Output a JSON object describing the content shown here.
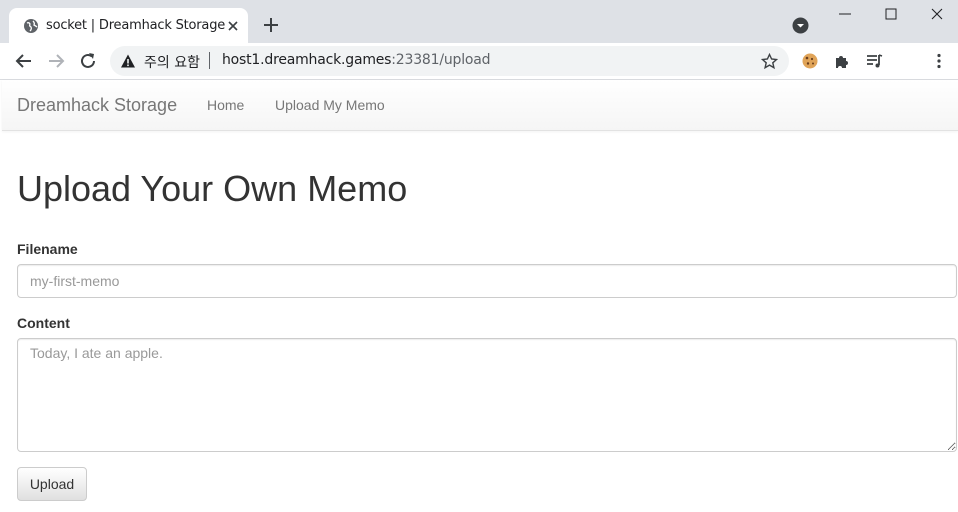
{
  "browser": {
    "tab_title": "socket | Dreamhack Storage",
    "security_label": "주의 요함",
    "url_host": "host1.dreamhack.games",
    "url_path": ":23381/upload"
  },
  "nav": {
    "brand": "Dreamhack Storage",
    "links": [
      "Home",
      "Upload My Memo"
    ]
  },
  "page": {
    "title": "Upload Your Own Memo",
    "filename_label": "Filename",
    "filename_placeholder": "my-first-memo",
    "content_label": "Content",
    "content_placeholder": "Today, I ate an apple.",
    "submit_label": "Upload"
  }
}
